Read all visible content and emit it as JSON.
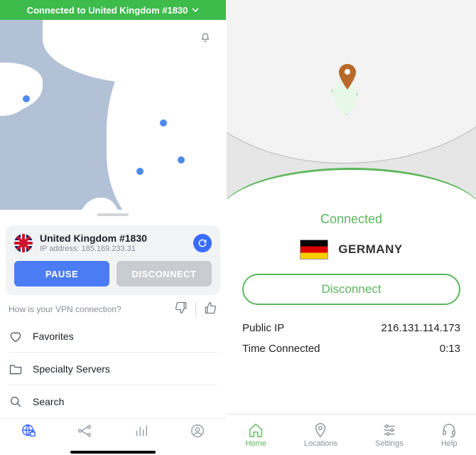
{
  "left": {
    "status": "Connected to United Kingdom #1830",
    "server_name": "United Kingdom #1830",
    "ip_label": "IP address: 185.169.233.31",
    "pause_label": "PAUSE",
    "disconnect_label": "DISCONNECT",
    "feedback_question": "How is your VPN connection?",
    "menu": {
      "favorites": "Favorites",
      "specialty": "Specialty Servers",
      "search": "Search"
    }
  },
  "right": {
    "connected_label": "Connected",
    "country": "GERMANY",
    "disconnect_label": "Disconnect",
    "public_ip_label": "Public IP",
    "public_ip_value": "216.131.114.173",
    "time_label": "Time Connected",
    "time_value": "0:13",
    "tabs": {
      "home": "Home",
      "locations": "Locations",
      "settings": "Settings",
      "help": "Help"
    }
  }
}
